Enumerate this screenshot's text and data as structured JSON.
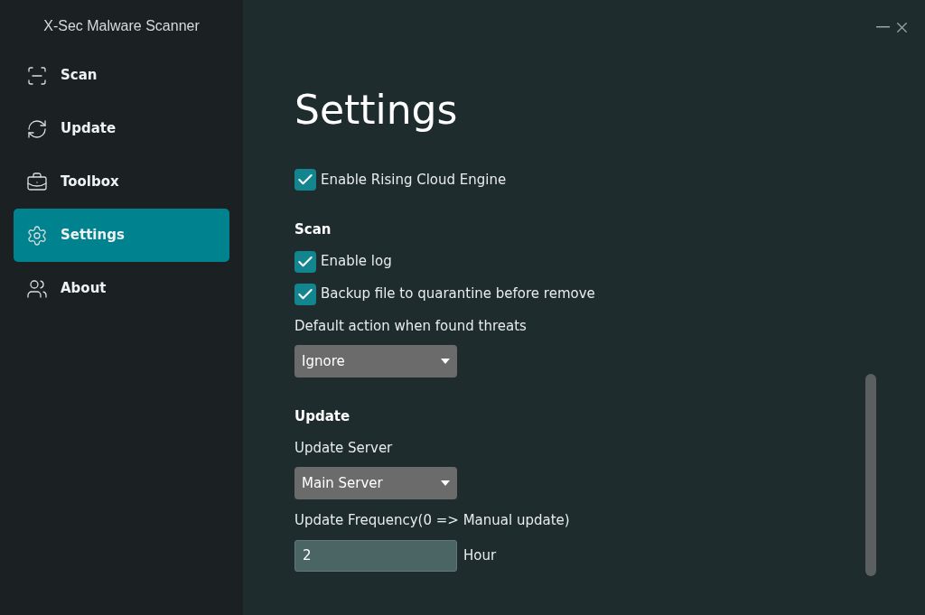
{
  "app_title": "X-Sec Malware Scanner",
  "sidebar": {
    "items": [
      {
        "label": "Scan",
        "kind": "scan",
        "selected": false
      },
      {
        "label": "Update",
        "kind": "update",
        "selected": false
      },
      {
        "label": "Toolbox",
        "kind": "toolbox",
        "selected": false
      },
      {
        "label": "Settings",
        "kind": "settings",
        "selected": true
      },
      {
        "label": "About",
        "kind": "about",
        "selected": false
      }
    ]
  },
  "page_title": "Settings",
  "settings": [
    {
      "kind": "checkbox",
      "label": "Enable Rising Cloud Engine",
      "checked": true
    },
    {
      "kind": "heading",
      "label": "Scan"
    },
    {
      "kind": "checkbox",
      "label": "Enable log",
      "checked": true
    },
    {
      "kind": "checkbox",
      "label": "Backup file to quarantine before remove",
      "checked": true
    },
    {
      "kind": "label",
      "label": "Default action when found threats"
    },
    {
      "kind": "select",
      "value": "Ignore"
    },
    {
      "kind": "heading",
      "label": "Update"
    },
    {
      "kind": "label",
      "label": "Update Server"
    },
    {
      "kind": "select",
      "value": "Main Server"
    },
    {
      "kind": "label",
      "label": "Update Frequency(0 => Manual update)"
    },
    {
      "kind": "input",
      "value": "2",
      "suffix": "Hour"
    }
  ]
}
